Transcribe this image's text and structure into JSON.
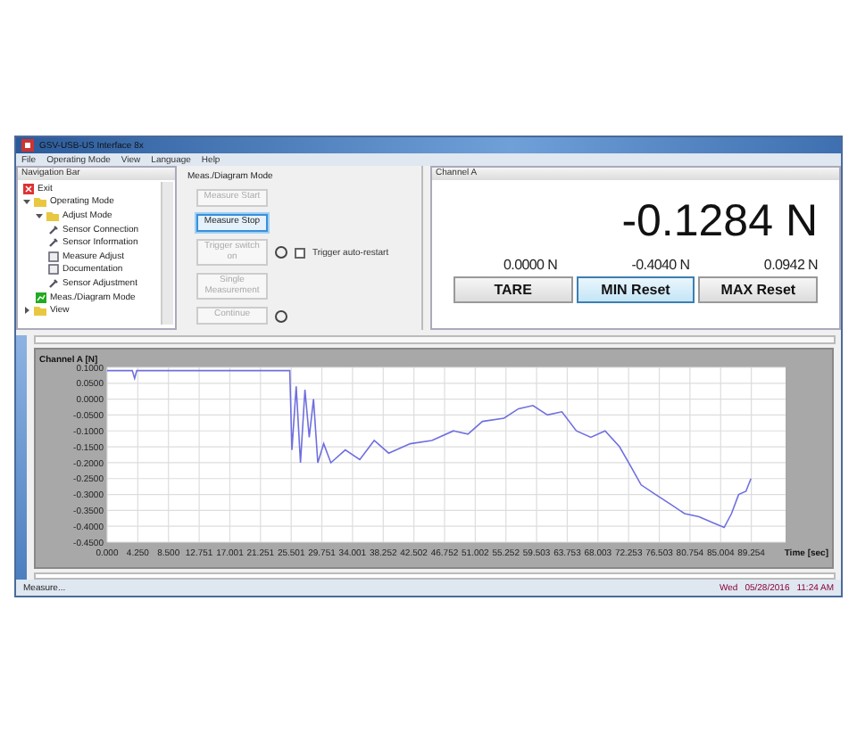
{
  "window": {
    "title": "GSV-USB-US Interface 8x"
  },
  "menu": [
    "File",
    "Operating Mode",
    "View",
    "Language",
    "Help"
  ],
  "navigation": {
    "title": "Navigation Bar",
    "items": [
      {
        "label": "Exit",
        "kind": "exit"
      },
      {
        "label": "Operating Mode",
        "kind": "folder",
        "expanded": true,
        "children": [
          {
            "label": "Adjust Mode",
            "kind": "folder",
            "expanded": true,
            "children": [
              {
                "label": "Sensor Connection",
                "kind": "tool"
              },
              {
                "label": "Sensor Information",
                "kind": "tool"
              },
              {
                "label": "Measure Adjust",
                "kind": "doc"
              },
              {
                "label": "Documentation",
                "kind": "doc"
              },
              {
                "label": "Sensor Adjustment",
                "kind": "tool"
              }
            ]
          },
          {
            "label": "Meas./Diagram Mode",
            "kind": "mode"
          }
        ]
      },
      {
        "label": "View",
        "kind": "folder",
        "expanded": false
      }
    ]
  },
  "measure_panel": {
    "title": "Meas./Diagram Mode",
    "controls": [
      {
        "label": "Measure Start",
        "disabled": true,
        "focused": false,
        "lamp": false
      },
      {
        "label": "Measure Stop",
        "disabled": false,
        "focused": true,
        "lamp": false
      },
      {
        "label": "Trigger switch on",
        "disabled": true,
        "focused": false,
        "lamp": true
      },
      {
        "label": "Single Measurement",
        "disabled": true,
        "focused": false,
        "lamp": false
      },
      {
        "label": "Continue",
        "disabled": true,
        "focused": false,
        "lamp": true
      }
    ],
    "auto_restart": {
      "label": "Trigger auto-restart",
      "checked": false
    }
  },
  "channel_panel": {
    "title": "Channel A",
    "reading": "-0.1284 N",
    "values": [
      "0.0000 N",
      "-0.4040 N",
      "0.0942 N"
    ],
    "buttons": [
      {
        "label": "TARE",
        "highlighted": false
      },
      {
        "label": "MIN Reset",
        "highlighted": true
      },
      {
        "label": "MAX Reset",
        "highlighted": false
      }
    ]
  },
  "chart": {
    "chart_data": {
      "type": "line",
      "grid": true,
      "xlabel": "Time [sec]",
      "ylabel": "Channel A [N]",
      "x": [
        0,
        3.5,
        3.8,
        4.1,
        10,
        20,
        25.3,
        25.6,
        26.2,
        26.8,
        27.4,
        28,
        28.6,
        29.2,
        30,
        31,
        33,
        35,
        37,
        39,
        42,
        45,
        48,
        50,
        52,
        55,
        57,
        59,
        61,
        63,
        65,
        67,
        69,
        71,
        72.5,
        74,
        76,
        78,
        80,
        82,
        84,
        85.5,
        86.5,
        87.5,
        88.5,
        89.2
      ],
      "series": [
        {
          "color": "#6f6fe0",
          "values": [
            0.09,
            0.09,
            0.065,
            0.09,
            0.09,
            0.09,
            0.09,
            -0.16,
            0.04,
            -0.2,
            0.03,
            -0.12,
            0.0,
            -0.2,
            -0.14,
            -0.2,
            -0.16,
            -0.19,
            -0.13,
            -0.17,
            -0.14,
            -0.13,
            -0.1,
            -0.11,
            -0.07,
            -0.06,
            -0.03,
            -0.02,
            -0.05,
            -0.04,
            -0.1,
            -0.12,
            -0.1,
            -0.15,
            -0.21,
            -0.27,
            -0.3,
            -0.33,
            -0.36,
            -0.37,
            -0.39,
            -0.404,
            -0.36,
            -0.3,
            -0.29,
            -0.25
          ]
        }
      ],
      "xlim": [
        0,
        94
      ],
      "ylim": [
        -0.45,
        0.1
      ],
      "xticks": [
        {
          "value": 0,
          "label": "0.000"
        },
        {
          "value": 4.25,
          "label": "4.250"
        },
        {
          "value": 8.5,
          "label": "8.500"
        },
        {
          "value": 12.751,
          "label": "12.751"
        },
        {
          "value": 17.001,
          "label": "17.001"
        },
        {
          "value": 21.251,
          "label": "21.251"
        },
        {
          "value": 25.501,
          "label": "25.501"
        },
        {
          "value": 29.751,
          "label": "29.751"
        },
        {
          "value": 34.001,
          "label": "34.001"
        },
        {
          "value": 38.252,
          "label": "38.252"
        },
        {
          "value": 42.502,
          "label": "42.502"
        },
        {
          "value": 46.752,
          "label": "46.752"
        },
        {
          "value": 51.002,
          "label": "51.002"
        },
        {
          "value": 55.252,
          "label": "55.252"
        },
        {
          "value": 59.503,
          "label": "59.503"
        },
        {
          "value": 63.753,
          "label": "63.753"
        },
        {
          "value": 68.003,
          "label": "68.003"
        },
        {
          "value": 72.253,
          "label": "72.253"
        },
        {
          "value": 76.503,
          "label": "76.503"
        },
        {
          "value": 80.754,
          "label": "80.754"
        },
        {
          "value": 85.004,
          "label": "85.004"
        },
        {
          "value": 89.254,
          "label": "89.254"
        }
      ],
      "yticks": [
        {
          "value": 0.1,
          "label": "0.1000"
        },
        {
          "value": 0.05,
          "label": "0.0500"
        },
        {
          "value": 0,
          "label": "0.0000"
        },
        {
          "value": -0.05,
          "label": "-0.0500"
        },
        {
          "value": -0.1,
          "label": "-0.1000"
        },
        {
          "value": -0.15,
          "label": "-0.1500"
        },
        {
          "value": -0.2,
          "label": "-0.2000"
        },
        {
          "value": -0.25,
          "label": "-0.2500"
        },
        {
          "value": -0.3,
          "label": "-0.3000"
        },
        {
          "value": -0.35,
          "label": "-0.3500"
        },
        {
          "value": -0.4,
          "label": "-0.4000"
        },
        {
          "value": -0.45,
          "label": "-0.4500"
        }
      ]
    }
  },
  "status_bar": {
    "left": "Measure...",
    "day": "Wed",
    "date": "05/28/2016",
    "time": "11:24 AM"
  }
}
